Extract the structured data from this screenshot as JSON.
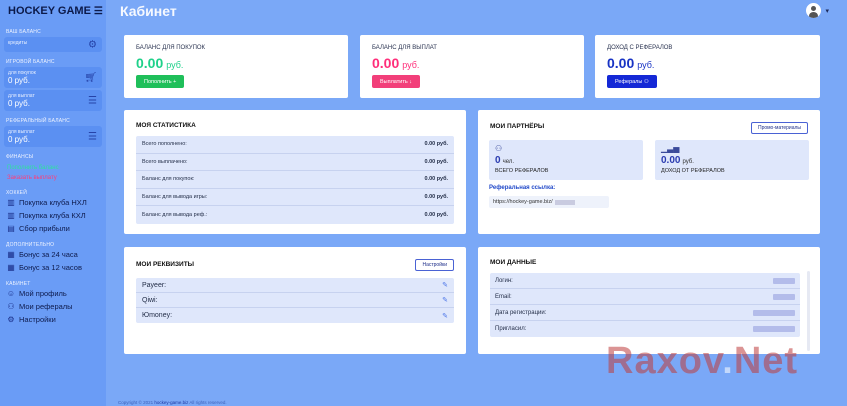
{
  "sidebar": {
    "logo": "HOCKEY GAME",
    "balance_section": "ваш баланс",
    "credits_label": "кредиты",
    "balance_section2": "игровой баланс",
    "buy_label": "для покупок",
    "buy_value": "0 руб.",
    "withdraw_label": "для выплат",
    "withdraw_value": "0 руб.",
    "ref_section": "реферальный баланс",
    "ref_withdraw_label": "для выплат",
    "ref_withdraw_value": "0 руб.",
    "finance_section": "финансы",
    "topup_link": "Пополнить баланс",
    "payout_link": "Заказать выплату",
    "hockey_section": "хоккей",
    "nav_hockey": [
      {
        "label": "Покупка клуба НХЛ",
        "icon": "building-icon"
      },
      {
        "label": "Покупка клуба КХЛ",
        "icon": "building-icon"
      },
      {
        "label": "Сбор прибыли",
        "icon": "wallet-icon"
      }
    ],
    "extra_section": "дополнительно",
    "nav_extra": [
      {
        "label": "Бонус за 24 часа",
        "icon": "gift-icon"
      },
      {
        "label": "Бонус за 12 часов",
        "icon": "gift-icon"
      }
    ],
    "cabinet_section": "кабинет",
    "nav_cabinet": [
      {
        "label": "Мой профиль",
        "icon": "user-icon"
      },
      {
        "label": "Мои рефералы",
        "icon": "users-icon"
      },
      {
        "label": "Настройки",
        "icon": "gear-icon"
      }
    ]
  },
  "header": {
    "title": "Кабинет"
  },
  "balances": [
    {
      "title": "баланс для покупок",
      "amount": "0.00",
      "currency": "руб.",
      "button": "Пополнить +",
      "color": "#1fd18a",
      "btn_color": "#1fbf5a"
    },
    {
      "title": "баланс для выплат",
      "amount": "0.00",
      "currency": "руб.",
      "button": "Выплатить ↓",
      "color": "#ff2e7a",
      "btn_color": "#f23f7a"
    },
    {
      "title": "доход с рефералов",
      "amount": "0.00",
      "currency": "руб.",
      "button": "Рефералы ⚇",
      "color": "#1833c4",
      "btn_color": "#1428d6"
    }
  ],
  "stats": {
    "title": "моя статистика",
    "rows": [
      {
        "label": "Всего пополнено:",
        "value": "0.00 руб."
      },
      {
        "label": "Всего выплачено:",
        "value": "0.00 руб."
      },
      {
        "label": "Баланс для покупок:",
        "value": "0.00 руб."
      },
      {
        "label": "Баланс для вывода игры:",
        "value": "0.00 руб."
      },
      {
        "label": "Баланс для вывода реф.:",
        "value": "0.00 руб."
      }
    ]
  },
  "partners": {
    "title": "мои партнёры",
    "promo_button": "Промо-материалы",
    "count_value": "0",
    "count_unit": "чел.",
    "count_label": "всего рефералов",
    "income_value": "0.00",
    "income_unit": "руб.",
    "income_label": "доход от рефералов",
    "ref_link_label": "Реферальная ссылка:",
    "ref_link": "https://hockey-game.biz/"
  },
  "requisites": {
    "title": "мои реквизиты",
    "settings_button": "Настройки",
    "rows": [
      {
        "label": "Payeer:"
      },
      {
        "label": "Qiwi:"
      },
      {
        "label": "Юmoney:"
      }
    ]
  },
  "my_data": {
    "title": "мои данные",
    "rows": [
      {
        "label": "Логин:"
      },
      {
        "label": "Email:"
      },
      {
        "label": "Дата регистрации:"
      },
      {
        "label": "Пригласил:"
      }
    ]
  },
  "footer": {
    "copy": "Copyright © 2021",
    "site": "hockey-game.biz",
    "rights": "All rights reserved."
  },
  "watermark": {
    "part1": "Raxov",
    "part2": ".",
    "part3": "Net"
  }
}
